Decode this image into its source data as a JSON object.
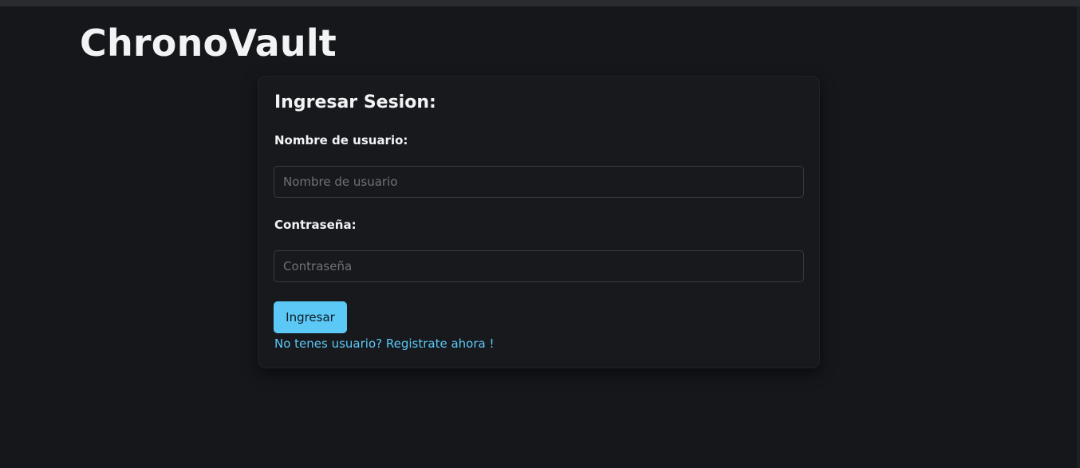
{
  "app": {
    "brand": "ChronoVault"
  },
  "login": {
    "title": "Ingresar Sesion:",
    "username_label": "Nombre de usuario:",
    "username_placeholder": "Nombre de usuario",
    "username_value": "",
    "password_label": "Contraseña:",
    "password_placeholder": "Contraseña",
    "password_value": "",
    "submit_label": "Ingresar",
    "register_link": "No tenes usuario? Registrate ahora !"
  },
  "colors": {
    "background": "#15171b",
    "card": "#17191d",
    "accent": "#5cc8f5",
    "text": "#f1f3f5"
  }
}
